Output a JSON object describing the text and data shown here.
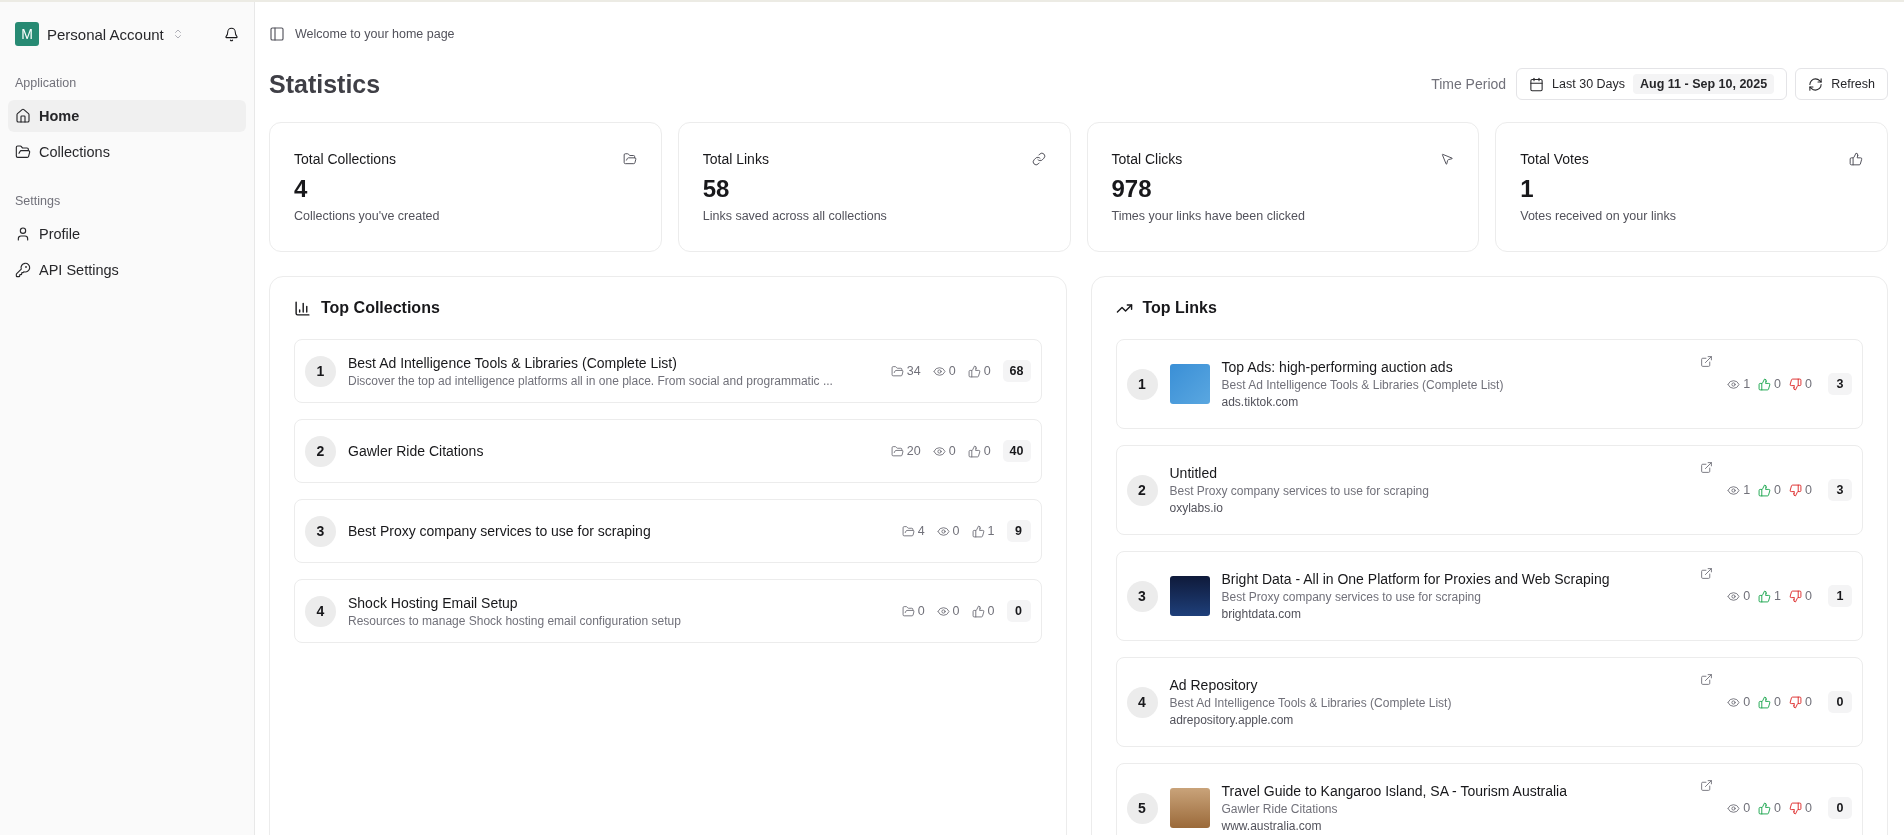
{
  "sidebar": {
    "account": {
      "initial": "M",
      "name": "Personal Account"
    },
    "sections": [
      {
        "title": "Application",
        "items": [
          {
            "label": "Home",
            "selected": true
          },
          {
            "label": "Collections",
            "selected": false
          }
        ]
      },
      {
        "title": "Settings",
        "items": [
          {
            "label": "Profile",
            "selected": false
          },
          {
            "label": "API Settings",
            "selected": false
          }
        ]
      }
    ]
  },
  "breadcrumb": "Welcome to your home page",
  "header": {
    "title": "Statistics",
    "period_label": "Time Period",
    "period": "Last 30 Days",
    "range": "Aug 11 - Sep 10, 2025",
    "refresh": "Refresh"
  },
  "stats": [
    {
      "title": "Total Collections",
      "value": "4",
      "caption": "Collections you've created"
    },
    {
      "title": "Total Links",
      "value": "58",
      "caption": "Links saved across all collections"
    },
    {
      "title": "Total Clicks",
      "value": "978",
      "caption": "Times your links have been clicked"
    },
    {
      "title": "Total Votes",
      "value": "1",
      "caption": "Votes received on your links"
    }
  ],
  "top_collections": {
    "title": "Top Collections",
    "rows": [
      {
        "rank": "1",
        "name": "Best Ad Intelligence Tools & Libraries (Complete List)",
        "description": "Discover the top ad intelligence platforms all in one place. From social and programmatic ...",
        "links": "34",
        "views": "0",
        "votes": "0",
        "score": "68"
      },
      {
        "rank": "2",
        "name": "Gawler Ride Citations",
        "links": "20",
        "views": "0",
        "votes": "0",
        "score": "40"
      },
      {
        "rank": "3",
        "name": "Best Proxy company services to use for scraping",
        "links": "4",
        "views": "0",
        "votes": "1",
        "score": "9"
      },
      {
        "rank": "4",
        "name": "Shock Hosting Email Setup",
        "description": "Resources to manage Shock hosting email configuration setup",
        "links": "0",
        "views": "0",
        "votes": "0",
        "score": "0"
      }
    ]
  },
  "top_links": {
    "title": "Top Links",
    "rows": [
      {
        "rank": "1",
        "thumbnail": true,
        "title": "Top Ads: high-performing auction ads",
        "collection": "Best Ad Intelligence Tools & Libraries (Complete List)",
        "domain": "ads.tiktok.com",
        "views": "1",
        "upvotes": "0",
        "downvotes": "0",
        "score": "3"
      },
      {
        "rank": "2",
        "thumbnail": false,
        "title": "Untitled",
        "collection": "Best Proxy company services to use for scraping",
        "domain": "oxylabs.io",
        "views": "1",
        "upvotes": "0",
        "downvotes": "0",
        "score": "3"
      },
      {
        "rank": "3",
        "thumbnail": true,
        "title": "Bright Data - All in One Platform for Proxies and Web Scraping",
        "collection": "Best Proxy company services to use for scraping",
        "domain": "brightdata.com",
        "views": "0",
        "upvotes": "1",
        "downvotes": "0",
        "score": "1"
      },
      {
        "rank": "4",
        "thumbnail": false,
        "title": "Ad Repository",
        "collection": "Best Ad Intelligence Tools & Libraries (Complete List)",
        "domain": "adrepository.apple.com",
        "views": "0",
        "upvotes": "0",
        "downvotes": "0",
        "score": "0"
      },
      {
        "rank": "5",
        "thumbnail": true,
        "title": "Travel Guide to Kangaroo Island, SA - Tourism Australia",
        "collection": "Gawler Ride Citations",
        "domain": "www.australia.com",
        "views": "0",
        "upvotes": "0",
        "downvotes": "0",
        "score": "0"
      }
    ]
  }
}
